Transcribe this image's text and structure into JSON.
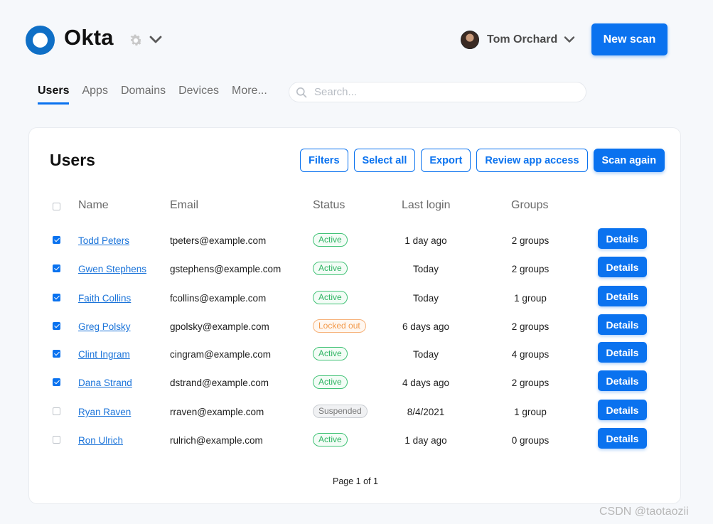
{
  "brand": {
    "name": "Okta",
    "accent": "#0a72ef",
    "logo_color": "#0f6fc6"
  },
  "header": {
    "settings_icon": "gear-icon",
    "user_name": "Tom Orchard",
    "new_scan_label": "New scan"
  },
  "tabs": [
    {
      "label": "Users",
      "active": true
    },
    {
      "label": "Apps",
      "active": false
    },
    {
      "label": "Domains",
      "active": false
    },
    {
      "label": "Devices",
      "active": false
    },
    {
      "label": "More...",
      "active": false
    }
  ],
  "search": {
    "placeholder": "Search...",
    "value": ""
  },
  "card": {
    "title": "Users",
    "toolbar": {
      "filters": "Filters",
      "select_all": "Select all",
      "export": "Export",
      "review_app_access": "Review app access",
      "scan_again": "Scan again"
    },
    "columns": {
      "name": "Name",
      "email": "Email",
      "status": "Status",
      "last_login": "Last login",
      "groups": "Groups"
    },
    "rows": [
      {
        "checked": true,
        "name": "Todd Peters",
        "email": "tpeters@example.com",
        "status": "Active",
        "status_kind": "active",
        "last_login": "1 day ago",
        "groups": "2 groups",
        "action": "Details"
      },
      {
        "checked": true,
        "name": "Gwen Stephens",
        "email": "gstephens@example.com",
        "status": "Active",
        "status_kind": "active",
        "last_login": "Today",
        "groups": "2 groups",
        "action": "Details"
      },
      {
        "checked": true,
        "name": "Faith Collins",
        "email": "fcollins@example.com",
        "status": "Active",
        "status_kind": "active",
        "last_login": "Today",
        "groups": "1 group",
        "action": "Details"
      },
      {
        "checked": true,
        "name": "Greg Polsky",
        "email": "gpolsky@example.com",
        "status": "Locked out",
        "status_kind": "locked",
        "last_login": "6 days ago",
        "groups": "2 groups",
        "action": "Details"
      },
      {
        "checked": true,
        "name": "Clint Ingram",
        "email": "cingram@example.com",
        "status": "Active",
        "status_kind": "active",
        "last_login": "Today",
        "groups": "4 groups",
        "action": "Details"
      },
      {
        "checked": true,
        "name": "Dana Strand",
        "email": "dstrand@example.com",
        "status": "Active",
        "status_kind": "active",
        "last_login": "4 days ago",
        "groups": "2 groups",
        "action": "Details"
      },
      {
        "checked": false,
        "name": "Ryan Raven",
        "email": "rraven@example.com",
        "status": "Suspended",
        "status_kind": "suspended",
        "last_login": "8/4/2021",
        "groups": "1 group",
        "action": "Details"
      },
      {
        "checked": false,
        "name": "Ron Ulrich",
        "email": "rulrich@example.com",
        "status": "Active",
        "status_kind": "active",
        "last_login": "1 day ago",
        "groups": "0 groups",
        "action": "Details"
      }
    ],
    "pagination": "Page 1 of 1"
  },
  "watermark": "CSDN @taotaozii"
}
